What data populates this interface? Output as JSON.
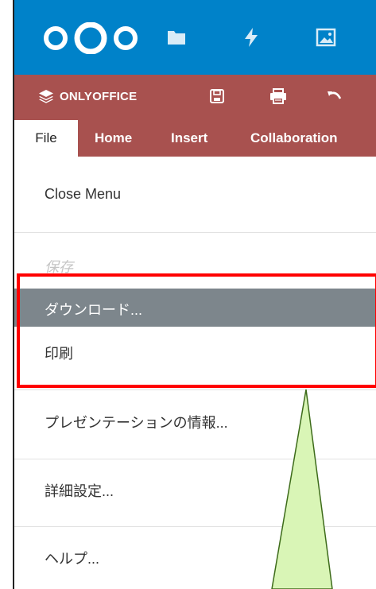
{
  "nextcloud_bar": {
    "logo": "nextcloud-logo",
    "icons": [
      "folder-icon",
      "activity-icon",
      "gallery-icon"
    ]
  },
  "onlyoffice": {
    "brand": "ONLYOFFICE",
    "tools": [
      "save-icon",
      "print-icon",
      "undo-icon"
    ]
  },
  "tabs": [
    {
      "label": "File"
    },
    {
      "label": "Home"
    },
    {
      "label": "Insert"
    },
    {
      "label": "Collaboration"
    }
  ],
  "menu": {
    "close": "Close Menu",
    "save": "保存",
    "download": "ダウンロード...",
    "print": "印刷",
    "info": "プレゼンテーションの情報...",
    "advanced": "詳細設定...",
    "help": "ヘルプ..."
  },
  "colors": {
    "nextcloud_blue": "#0082c9",
    "onlyoffice_red": "#a8514f",
    "highlight_gray": "#7d868c",
    "annotation_red": "#ff0000",
    "callout_green": "#d9f5b6"
  }
}
